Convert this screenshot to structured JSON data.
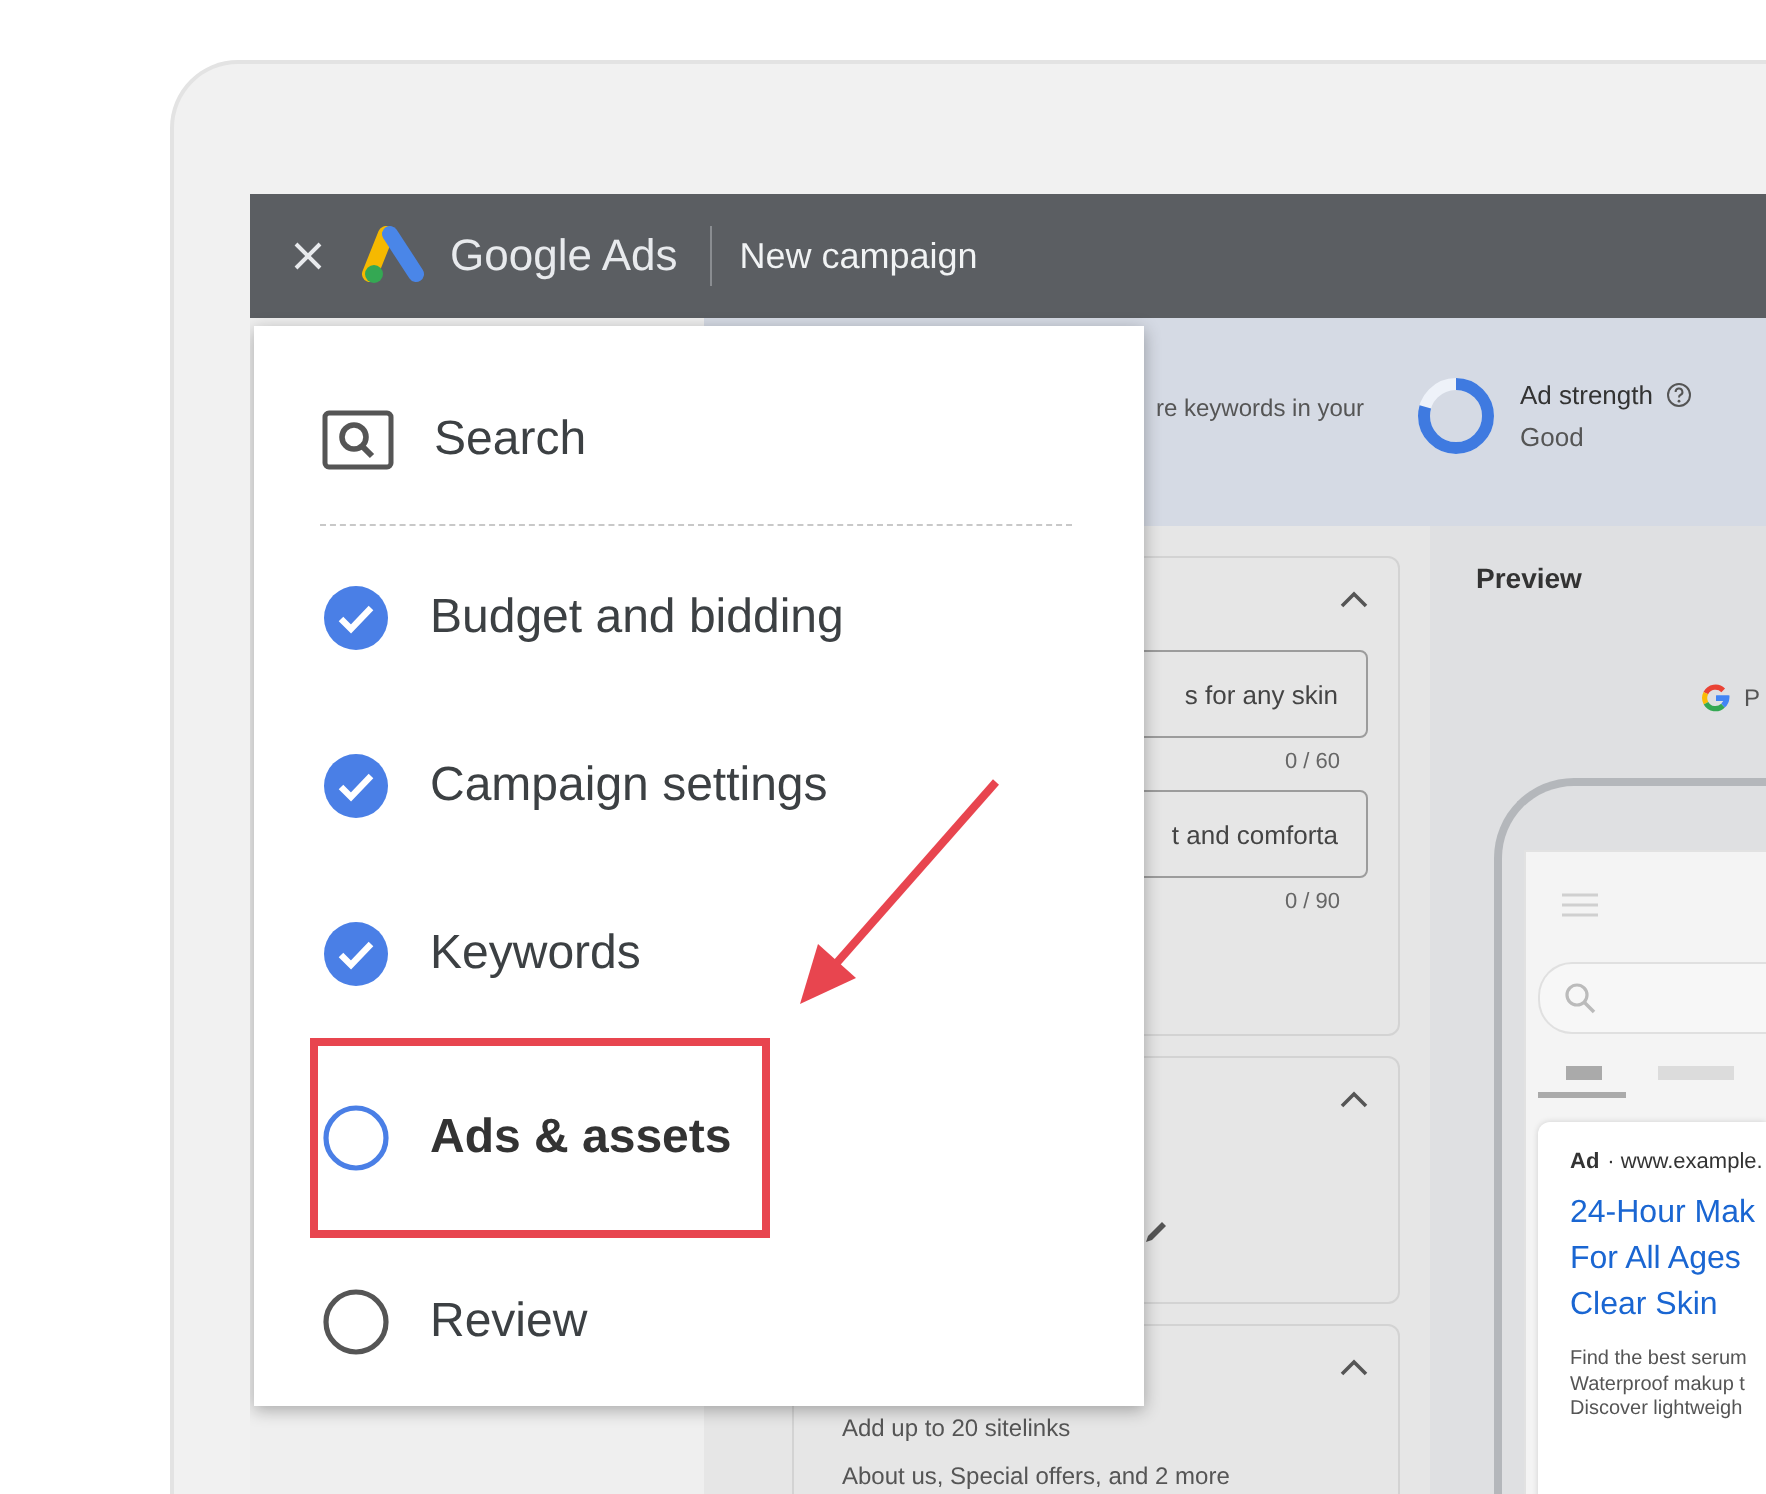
{
  "top_bar": {
    "product": "Google Ads",
    "title": "New campaign"
  },
  "menu": {
    "items": [
      {
        "label": "Search",
        "kind": "header"
      },
      {
        "label": "Budget and bidding",
        "kind": "step",
        "completed": true,
        "selected": false,
        "callout": false
      },
      {
        "label": "Campaign settings",
        "kind": "step",
        "completed": true,
        "selected": false,
        "callout": false
      },
      {
        "label": "Keywords",
        "kind": "step",
        "completed": true,
        "selected": false,
        "callout": false
      },
      {
        "label": "Ads & assets",
        "kind": "step",
        "completed": false,
        "selected": true,
        "callout": true
      },
      {
        "label": "Review",
        "kind": "step",
        "completed": false,
        "selected": false,
        "callout": false
      }
    ]
  },
  "banner": {
    "text": "re keywords in your",
    "ad_strength": {
      "label": "Ad strength",
      "rating": "Good",
      "level": 0.8
    }
  },
  "cards": [
    {
      "kind": "fields",
      "expanded": true,
      "fields": [
        {
          "value": "s for any skin",
          "counter": "0 / 60"
        },
        {
          "value": "t and comforta",
          "counter": "0 / 90"
        }
      ]
    },
    {
      "kind": "edit",
      "expanded": true
    },
    {
      "kind": "text",
      "expanded": true,
      "lines": [
        "Add up to 20 sitelinks",
        "About us, Special offers, and 2 more"
      ]
    }
  ],
  "preview": {
    "title": "Preview",
    "label": "P",
    "ad": {
      "badge": "Ad",
      "url": "· www.example.",
      "headline": [
        "24-Hour Mak",
        "For All Ages",
        "Clear Skin"
      ],
      "description": [
        "Find the best serum",
        "Waterproof makup t",
        "Discover lightweigh"
      ]
    }
  }
}
